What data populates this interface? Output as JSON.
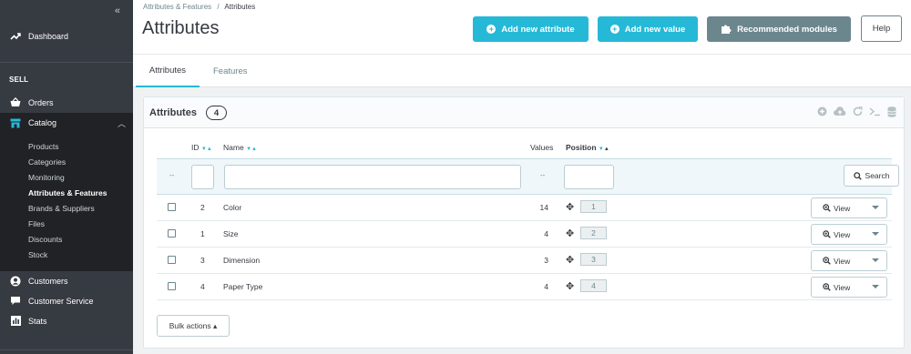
{
  "sidebar": {
    "collapse_glyph": "«",
    "dashboard": "Dashboard",
    "section_sell": "SELL",
    "orders": "Orders",
    "catalog": "Catalog",
    "submenu": [
      "Products",
      "Categories",
      "Monitoring",
      "Attributes & Features",
      "Brands & Suppliers",
      "Files",
      "Discounts",
      "Stock"
    ],
    "customers": "Customers",
    "customer_service": "Customer Service",
    "stats": "Stats"
  },
  "header": {
    "breadcrumb_parent": "Attributes & Features",
    "breadcrumb_sep": "/",
    "breadcrumb_current": "Attributes",
    "title": "Attributes",
    "add_attribute": "Add new attribute",
    "add_value": "Add new value",
    "recommended": "Recommended modules",
    "help": "Help"
  },
  "tabs": [
    "Attributes",
    "Features"
  ],
  "table": {
    "title": "Attributes",
    "count": "4",
    "columns": {
      "id": "ID",
      "name": "Name",
      "values": "Values",
      "position": "Position"
    },
    "filter_placeholder_dash": "--",
    "search_label": "Search",
    "rows": [
      {
        "id": "2",
        "name": "Color",
        "values": "14",
        "position": "1"
      },
      {
        "id": "1",
        "name": "Size",
        "values": "4",
        "position": "2"
      },
      {
        "id": "3",
        "name": "Dimension",
        "values": "3",
        "position": "3"
      },
      {
        "id": "4",
        "name": "Paper Type",
        "values": "4",
        "position": "4"
      }
    ],
    "view_label": "View",
    "bulk_actions": "Bulk actions ▴"
  },
  "colors": {
    "accent": "#25b9d7",
    "sidebar": "#363a41",
    "sidebar_active": "#202226",
    "grey_button": "#6c868e"
  }
}
